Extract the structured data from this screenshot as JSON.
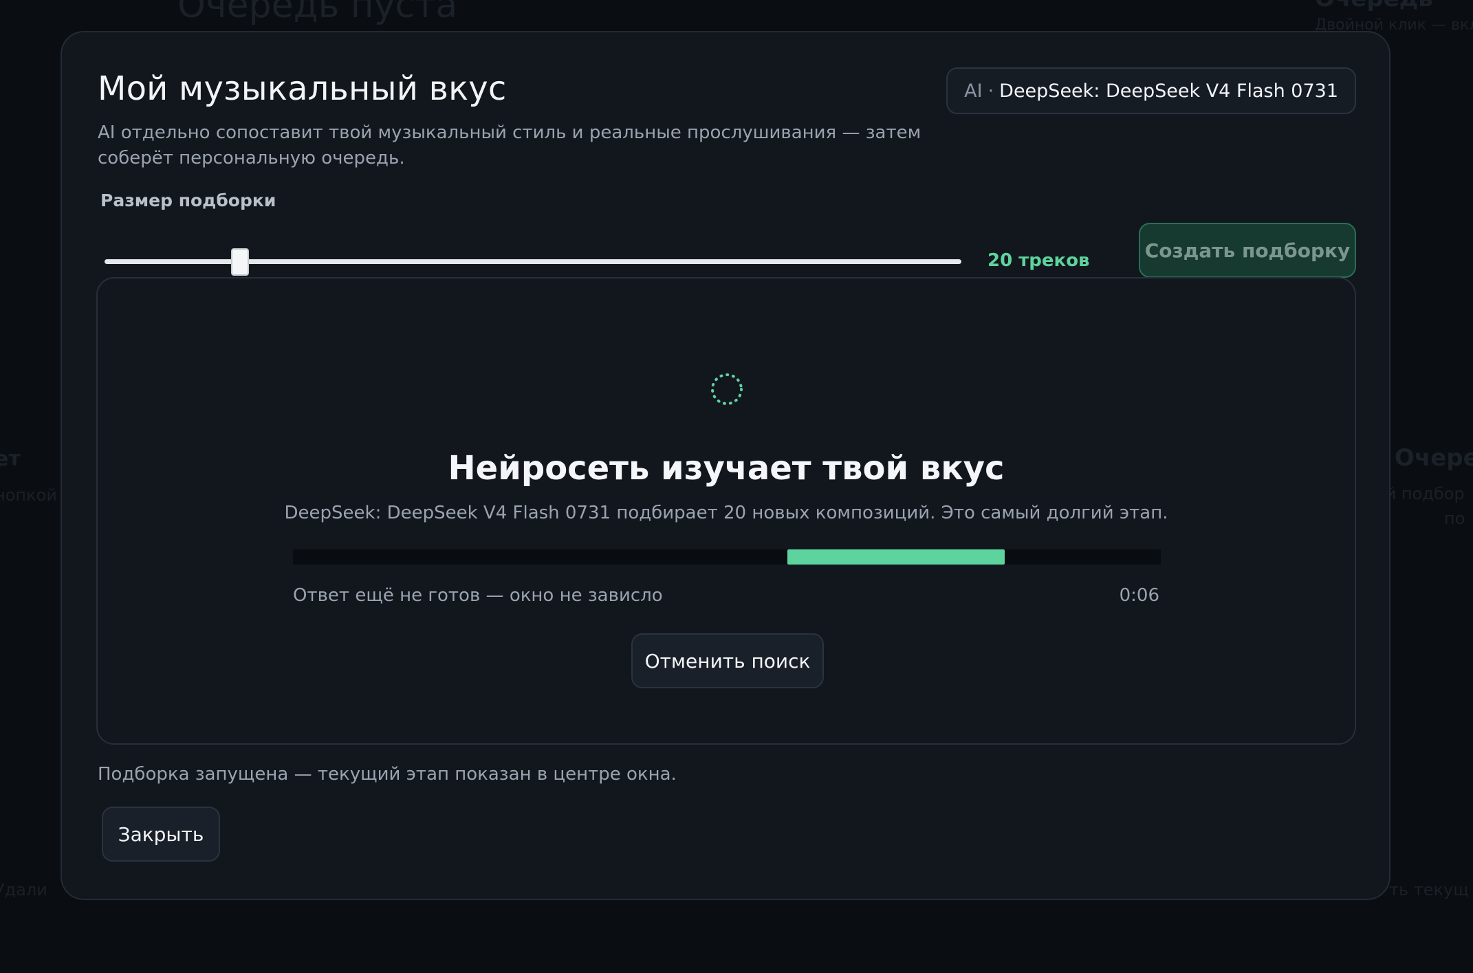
{
  "background": {
    "title": "Очередь пуста",
    "right_heading": "Очередь",
    "right_sub": "Двойной клик — вкл",
    "left_mid_heading": "ет",
    "left_mid_sub": "нопкой",
    "right_mid_heading": "Очеред",
    "right_mid_sub": "ай подбор",
    "right_mid_sub2": "по",
    "left_bottom": "Удали",
    "right_bottom": "ть текущ"
  },
  "modal": {
    "title": "Мой музыкальный вкус",
    "model_badge": {
      "prefix": "AI",
      "separator": "·",
      "model": "DeepSeek: DeepSeek V4 Flash 0731"
    },
    "description": "AI отдельно сопоставит твой музыкальный стиль и реальные прослушивания — затем соберёт персональную очередь.",
    "size_label": "Размер подборки",
    "slider": {
      "value": 20,
      "min": 5,
      "max": 100
    },
    "track_count_label": "20 треков",
    "create_button_label": "Создать подборку",
    "footer_note": "Подборка запущена — текущий этап показан в центре окна.",
    "close_button_label": "Закрыть"
  },
  "progress_panel": {
    "title": "Нейросеть изучает твой вкус",
    "description": "DeepSeek: DeepSeek V4 Flash 0731 подбирает 20 новых композиций. Это самый долгий этап.",
    "progress_fill_start": 0.57,
    "progress_fill_end": 0.82,
    "status_text": "Ответ ещё не готов — окно не зависло",
    "elapsed_time": "0:06",
    "cancel_button_label": "Отменить поиск"
  },
  "colors": {
    "accent": "#5ed39c",
    "modal_bg": "#12171e",
    "page_bg": "#0a0d11"
  }
}
